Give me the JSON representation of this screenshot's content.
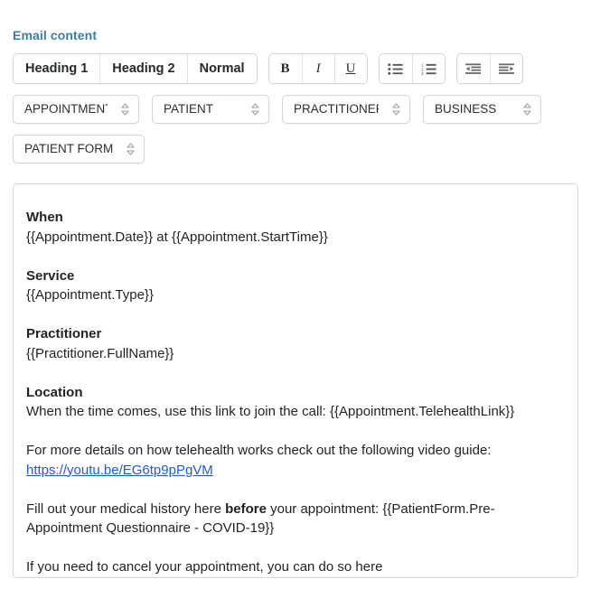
{
  "field": {
    "label": "Email content"
  },
  "toolbar": {
    "style_buttons": [
      {
        "label": "Heading 1",
        "name": "heading-1-button"
      },
      {
        "label": "Heading 2",
        "name": "heading-2-button"
      },
      {
        "label": "Normal",
        "name": "normal-text-button"
      }
    ],
    "format_buttons": [
      {
        "label": "B",
        "name": "bold-button"
      },
      {
        "label": "I",
        "name": "italic-button"
      },
      {
        "label": "U",
        "name": "underline-button"
      }
    ],
    "list_buttons": [
      {
        "icon": "bullet-list-icon",
        "name": "bullet-list-button"
      },
      {
        "icon": "numbered-list-icon",
        "name": "numbered-list-button"
      }
    ],
    "indent_buttons": [
      {
        "icon": "indent-decrease-icon",
        "name": "outdent-button"
      },
      {
        "icon": "indent-increase-icon",
        "name": "indent-button"
      }
    ]
  },
  "merge_fields": [
    {
      "name": "merge-field-appointment",
      "value": "APPOINTMENT"
    },
    {
      "name": "merge-field-patient",
      "value": "PATIENT"
    },
    {
      "name": "merge-field-practitioner",
      "value": "PRACTITIONER"
    },
    {
      "name": "merge-field-business",
      "value": "BUSINESS"
    },
    {
      "name": "merge-field-patient-form",
      "value": "PATIENT FORM"
    }
  ],
  "email_body": {
    "when_heading": "When",
    "when_text": "{{Appointment.Date}} at {{Appointment.StartTime}}",
    "service_heading": "Service",
    "service_text": "{{Appointment.Type}}",
    "practitioner_heading": "Practitioner",
    "practitioner_text": "{{Practitioner.FullName}}",
    "location_heading": "Location",
    "location_text": "When the time comes, use this link to join the call: {{Appointment.TelehealthLink}}",
    "video_text_before": "For more details on how telehealth works check out the following video guide: ",
    "video_link": "https://youtu.be/EG6tp9pPgVM",
    "form_text_before": "Fill out your medical history here ",
    "form_text_bold": "before",
    "form_text_after": " your appointment: {{PatientForm.Pre-Appointment Questionnaire - COVID-19}}",
    "cancel_text": "If you need to cancel your appointment, you can do so here {{Appointment.CancellationLink}}"
  },
  "colors": {
    "label_accent": "#3a7ca5",
    "link": "#1a5fd0",
    "border": "#d4d4d4"
  }
}
